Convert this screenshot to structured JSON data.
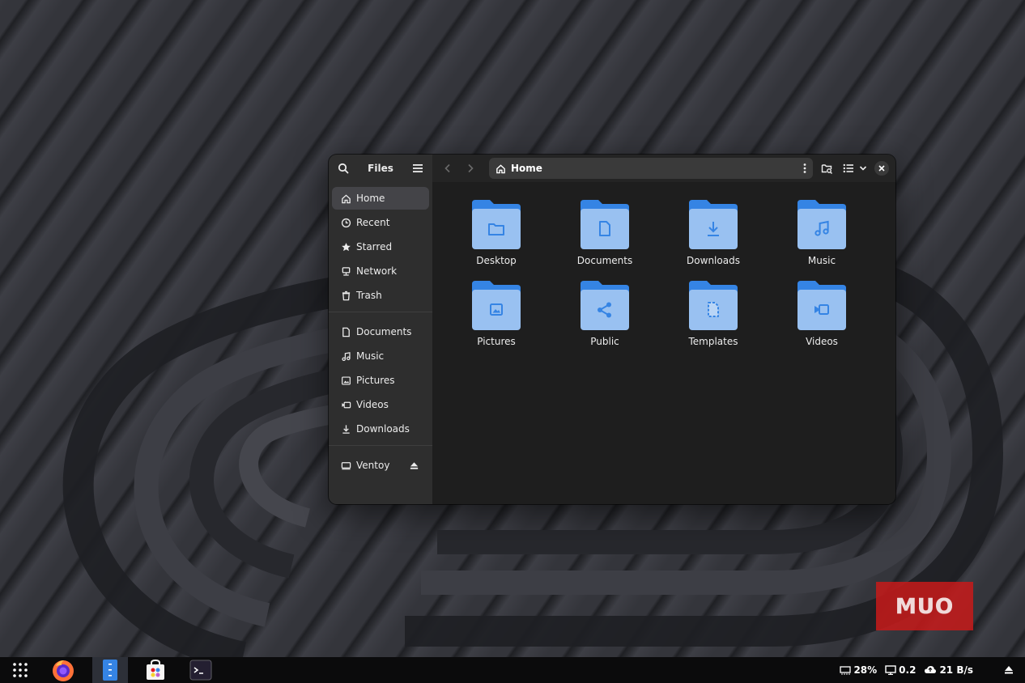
{
  "window": {
    "app_title": "Files",
    "path": "Home"
  },
  "sidebar": {
    "places": [
      {
        "label": "Home",
        "icon": "home-icon",
        "active": true
      },
      {
        "label": "Recent",
        "icon": "clock-icon"
      },
      {
        "label": "Starred",
        "icon": "star-icon"
      },
      {
        "label": "Network",
        "icon": "network-icon"
      },
      {
        "label": "Trash",
        "icon": "trash-icon"
      }
    ],
    "bookmarks": [
      {
        "label": "Documents",
        "icon": "document-icon"
      },
      {
        "label": "Music",
        "icon": "music-icon"
      },
      {
        "label": "Pictures",
        "icon": "picture-icon"
      },
      {
        "label": "Videos",
        "icon": "video-icon"
      },
      {
        "label": "Downloads",
        "icon": "download-icon"
      }
    ],
    "devices": [
      {
        "label": "Ventoy",
        "icon": "drive-icon"
      }
    ]
  },
  "folders": [
    {
      "label": "Desktop",
      "icon": "folder-desktop-icon"
    },
    {
      "label": "Documents",
      "icon": "folder-documents-icon"
    },
    {
      "label": "Downloads",
      "icon": "folder-downloads-icon"
    },
    {
      "label": "Music",
      "icon": "folder-music-icon"
    },
    {
      "label": "Pictures",
      "icon": "folder-pictures-icon"
    },
    {
      "label": "Public",
      "icon": "folder-public-icon"
    },
    {
      "label": "Templates",
      "icon": "folder-templates-icon"
    },
    {
      "label": "Videos",
      "icon": "folder-videos-icon"
    }
  ],
  "taskbar": {
    "apps": [
      "app-grid-icon",
      "firefox-icon",
      "files-icon",
      "software-store-icon",
      "terminal-icon"
    ],
    "tray": {
      "memory": "28%",
      "display": "0.2",
      "network": "21 B/s"
    }
  },
  "watermark": {
    "text": "MUO"
  },
  "colors": {
    "folder_back": "#3584e4",
    "folder_front": "#99c1f1",
    "window_bg": "#1e1e1e",
    "sidebar_bg": "#2e2e2e",
    "watermark": "#c81a1a"
  }
}
